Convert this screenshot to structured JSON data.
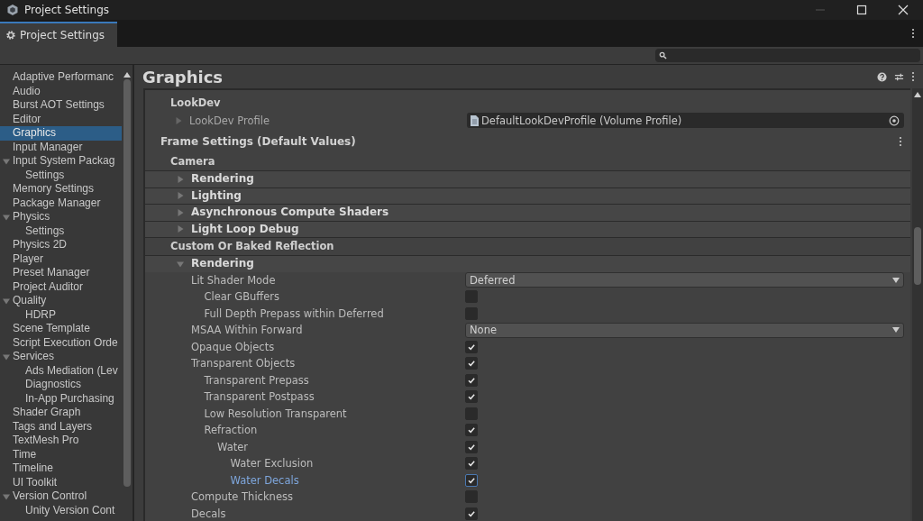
{
  "window": {
    "title": "Project Settings"
  },
  "tabs": [
    {
      "label": "Project Settings",
      "selected": true
    }
  ],
  "sidebar": {
    "items": [
      {
        "label": "Adaptive Performanc",
        "selected": false
      },
      {
        "label": "Audio",
        "selected": false
      },
      {
        "label": "Burst AOT Settings",
        "selected": false
      },
      {
        "label": "Editor",
        "selected": false
      },
      {
        "label": "Graphics",
        "selected": true
      },
      {
        "label": "Input Manager",
        "selected": false
      },
      {
        "label": "Input System Packag",
        "selected": false,
        "expanded": true,
        "children": [
          {
            "label": "Settings",
            "selected": false
          }
        ]
      },
      {
        "label": "Memory Settings",
        "selected": false
      },
      {
        "label": "Package Manager",
        "selected": false
      },
      {
        "label": "Physics",
        "selected": false,
        "expanded": true,
        "children": [
          {
            "label": "Settings",
            "selected": false
          }
        ]
      },
      {
        "label": "Physics 2D",
        "selected": false
      },
      {
        "label": "Player",
        "selected": false
      },
      {
        "label": "Preset Manager",
        "selected": false
      },
      {
        "label": "Project Auditor",
        "selected": false
      },
      {
        "label": "Quality",
        "selected": false,
        "expanded": true,
        "children": [
          {
            "label": "HDRP",
            "selected": false
          }
        ]
      },
      {
        "label": "Scene Template",
        "selected": false
      },
      {
        "label": "Script Execution Orde",
        "selected": false
      },
      {
        "label": "Services",
        "selected": false,
        "expanded": true,
        "children": [
          {
            "label": "Ads Mediation (Lev",
            "selected": false
          },
          {
            "label": "Diagnostics",
            "selected": false
          },
          {
            "label": "In-App Purchasing",
            "selected": false
          }
        ]
      },
      {
        "label": "Shader Graph",
        "selected": false
      },
      {
        "label": "Tags and Layers",
        "selected": false
      },
      {
        "label": "TextMesh Pro",
        "selected": false
      },
      {
        "label": "Time",
        "selected": false
      },
      {
        "label": "Timeline",
        "selected": false
      },
      {
        "label": "UI Toolkit",
        "selected": false
      },
      {
        "label": "Version Control",
        "selected": false,
        "expanded": true,
        "children": [
          {
            "label": "Unity Version Cont",
            "selected": false
          }
        ]
      }
    ]
  },
  "page": {
    "title": "Graphics",
    "lookdev": {
      "header": "LookDev",
      "label": "LookDev Profile",
      "expanded": false,
      "value": "DefaultLookDevProfile (Volume Profile)"
    },
    "frame_settings": {
      "title": "Frame Settings (Default Values)",
      "groups": [
        {
          "header": "Camera",
          "foldouts": [
            {
              "label": "Rendering",
              "expanded": false
            },
            {
              "label": "Lighting",
              "expanded": false
            },
            {
              "label": "Asynchronous Compute Shaders",
              "expanded": false
            },
            {
              "label": "Light Loop Debug",
              "expanded": false
            }
          ]
        },
        {
          "header": "Custom Or Baked Reflection",
          "foldouts": [
            {
              "label": "Rendering",
              "expanded": true,
              "rows": [
                {
                  "label": "Lit Shader Mode",
                  "kind": "dropdown",
                  "value": "Deferred",
                  "selected": false,
                  "children": [
                    {
                      "label": "Clear GBuffers",
                      "kind": "checkbox",
                      "checked": false,
                      "selected": false
                    },
                    {
                      "label": "Full Depth Prepass within Deferred",
                      "kind": "checkbox",
                      "checked": false,
                      "selected": false
                    }
                  ]
                },
                {
                  "label": "MSAA Within Forward",
                  "kind": "dropdown",
                  "value": "None",
                  "selected": false
                },
                {
                  "label": "Opaque Objects",
                  "kind": "checkbox",
                  "checked": true,
                  "selected": false
                },
                {
                  "label": "Transparent Objects",
                  "kind": "checkbox",
                  "checked": true,
                  "selected": false,
                  "children": [
                    {
                      "label": "Transparent Prepass",
                      "kind": "checkbox",
                      "checked": true,
                      "selected": false
                    },
                    {
                      "label": "Transparent Postpass",
                      "kind": "checkbox",
                      "checked": true,
                      "selected": false
                    },
                    {
                      "label": "Low Resolution Transparent",
                      "kind": "checkbox",
                      "checked": false,
                      "selected": false
                    },
                    {
                      "label": "Refraction",
                      "kind": "checkbox",
                      "checked": true,
                      "selected": false,
                      "children": [
                        {
                          "label": "Water",
                          "kind": "checkbox",
                          "checked": true,
                          "selected": false,
                          "children": [
                            {
                              "label": "Water Exclusion",
                              "kind": "checkbox",
                              "checked": true,
                              "selected": false
                            },
                            {
                              "label": "Water Decals",
                              "kind": "checkbox",
                              "checked": true,
                              "selected": true
                            }
                          ]
                        }
                      ]
                    }
                  ]
                },
                {
                  "label": "Compute Thickness",
                  "kind": "checkbox",
                  "checked": false,
                  "selected": false
                },
                {
                  "label": "Decals",
                  "kind": "checkbox",
                  "checked": true,
                  "selected": false
                }
              ]
            }
          ]
        }
      ]
    }
  }
}
